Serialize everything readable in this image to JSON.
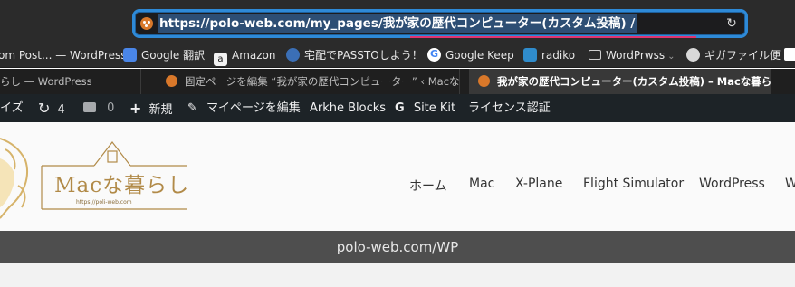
{
  "url": {
    "text": "https://polo-web.com/my_pages/我が家の歴代コンピューター(カスタム投稿) /"
  },
  "bookmarks": [
    {
      "label": "om Post... — WordPress",
      "icon": "none"
    },
    {
      "label": "Google 翻訳",
      "icon": "google-translate-icon"
    },
    {
      "label": "Amazon",
      "icon": "amazon-icon"
    },
    {
      "label": "宅配でPASSTOしよう！",
      "icon": "passto-icon"
    },
    {
      "label": "Google Keep",
      "icon": "google-icon"
    },
    {
      "label": "radiko",
      "icon": "radiko-icon"
    },
    {
      "label": "WordPrwss",
      "icon": "folder-icon"
    },
    {
      "label": "ギガファイル便",
      "icon": "gigafile-icon"
    }
  ],
  "tabs": [
    {
      "label": "らし — WordPress"
    },
    {
      "label": "固定ページを編集 “我が家の歴代コンピューター” ‹ Macな暮ら..."
    },
    {
      "label": "我が家の歴代コンピューター(カスタム投稿) – Macな暮らし",
      "active": true
    }
  ],
  "adminbar": {
    "customize": "イズ",
    "updates_count": "4",
    "comments_count": "0",
    "new": "新規",
    "edit_page": "マイページを編集",
    "arkhe": "Arkhe Blocks",
    "sitekit": "Site Kit",
    "license": "ライセンス認証"
  },
  "logo": {
    "title": "Macな暮らし",
    "tagline": "https://poli-web.com"
  },
  "nav": [
    "ホーム",
    "Mac",
    "X-Plane",
    "Flight Simulator",
    "WordPress",
    "W"
  ],
  "band": {
    "text": "polo-web.com/WP"
  },
  "colors": {
    "focus_ring": "#2e8ad8",
    "url_highlight": "#2d4e74",
    "underline": "#e0336e",
    "adminbar": "#1d2327",
    "logo_gold": "#b18a48",
    "band": "#4e4e4e"
  }
}
